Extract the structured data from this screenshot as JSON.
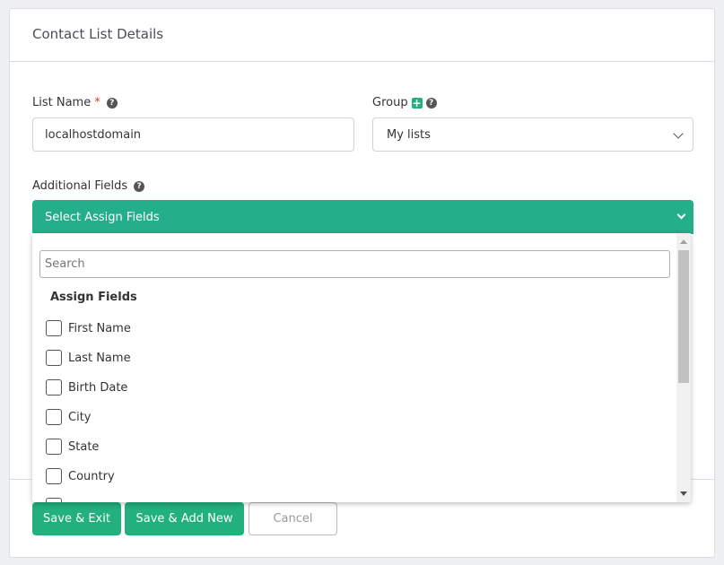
{
  "card": {
    "title": "Contact List Details"
  },
  "list_name": {
    "label": "List Name",
    "required_mark": "*",
    "help": "?",
    "value": "localhostdomain"
  },
  "group": {
    "label": "Group",
    "add": "+",
    "help": "?",
    "selected": "My lists"
  },
  "additional_fields": {
    "label": "Additional Fields",
    "help": "?",
    "select_label": "Select Assign Fields",
    "dropdown": {
      "search_placeholder": "Search",
      "group_label": "Assign Fields",
      "options": [
        "First Name",
        "Last Name",
        "Birth Date",
        "City",
        "State",
        "Country"
      ]
    }
  },
  "actions": {
    "save_exit": "Save & Exit",
    "save_add_new": "Save & Add New",
    "cancel": "Cancel"
  },
  "colors": {
    "accent": "#22b07d",
    "select_bg": "#25ae8a",
    "required": "#e03a3a"
  }
}
